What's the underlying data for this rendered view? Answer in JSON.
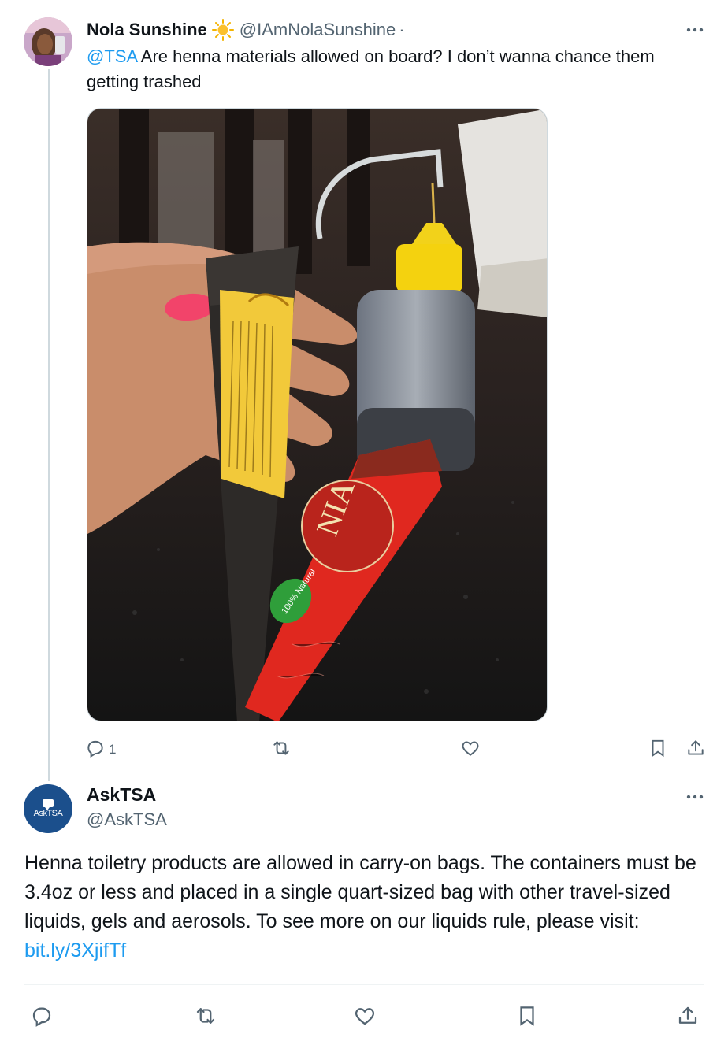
{
  "tweet1": {
    "author_name": "Nola Sunshine",
    "author_emoji_icon": "sun-icon",
    "author_handle": "@IAmNolaSunshine",
    "separator": "·",
    "text_mention": "@TSA",
    "text_body": " Are henna materials allowed on board? I don’t wanna chance them getting trashed",
    "reply_count": "1",
    "image_alt": "Hand holding a henna cone next to an applicator bottle and a red henna tube labeled NIA, 100% Natural"
  },
  "tweet2": {
    "author_name": "AskTSA",
    "author_handle": "@AskTSA",
    "avatar_text": "AskTSA",
    "text_body": "Henna toiletry products are allowed in carry-on bags. The containers must be 3.4oz or less and placed in a single quart-sized bag with other travel-sized liquids, gels and aerosols. To see more on our liquids rule, please visit: ",
    "link_text": "bit.ly/3XjifTf"
  },
  "colors": {
    "accent": "#1d9bf0",
    "secondary_text": "#536471",
    "primary_text": "#0f1419",
    "tsa_blue": "#1b4f8c"
  },
  "icons": [
    "more-icon",
    "reply-icon",
    "retweet-icon",
    "like-icon",
    "bookmark-icon",
    "share-icon"
  ]
}
